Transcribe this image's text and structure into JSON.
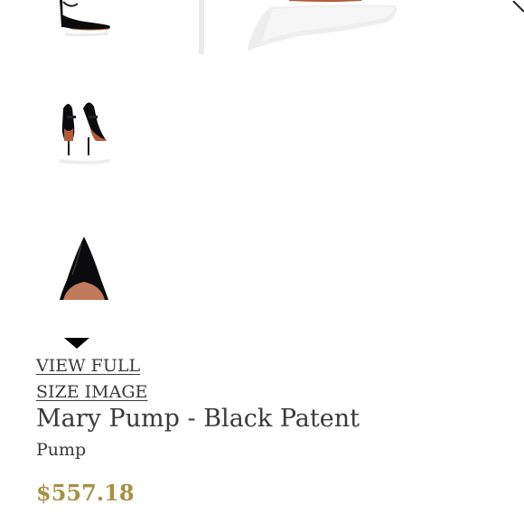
{
  "gallery": {
    "thumbnails": [
      {
        "icon": "shoe-side-view-thumbnail"
      },
      {
        "icon": "shoe-back-view-thumbnail"
      },
      {
        "icon": "shoe-top-view-thumbnail"
      }
    ],
    "main_image": {
      "icon": "shoe-main-image"
    },
    "scroll_down_icon": "triangle-down-icon",
    "view_full_label": "VIEW FULL SIZE IMAGE"
  },
  "product": {
    "title": "Mary Pump - Black Patent",
    "category": "Pump",
    "price": "$557.18"
  },
  "colors": {
    "text": "#3a3a3a",
    "price": "#a69145",
    "patent_black": "#0b0b0d",
    "sole": "#b35a3a"
  }
}
